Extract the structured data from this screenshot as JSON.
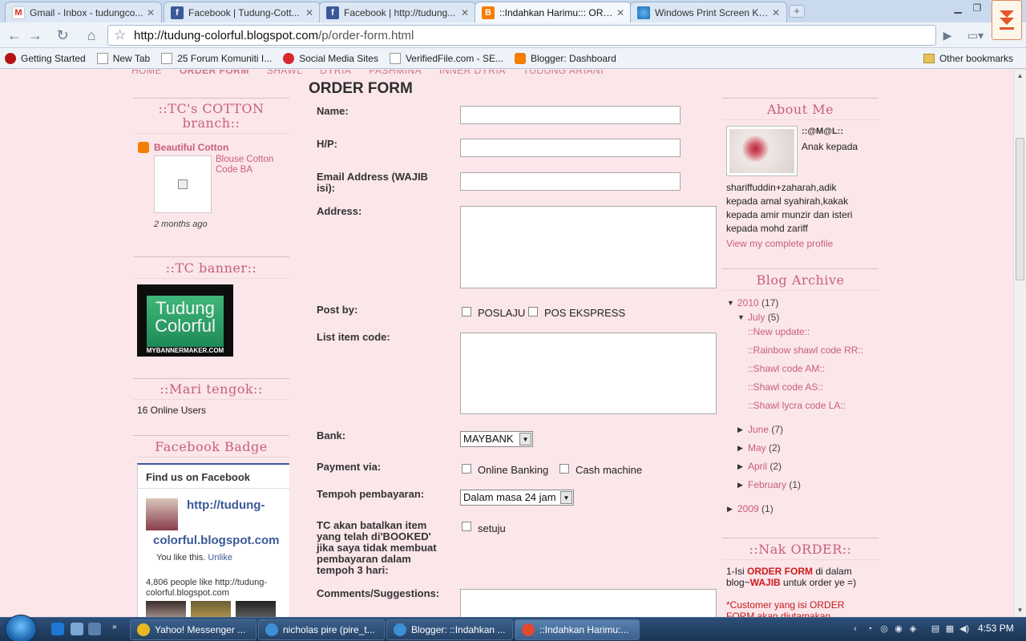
{
  "browser": {
    "tabs": [
      {
        "label": "Gmail - Inbox - tudungco...",
        "icon": "gmail-icon"
      },
      {
        "label": "Facebook | Tudung-Cott...",
        "icon": "facebook-icon"
      },
      {
        "label": "Facebook | http://tudung...",
        "icon": "facebook-icon"
      },
      {
        "label": "::Indahkan Harimu::: ORD...",
        "icon": "blogger-icon",
        "active": true
      },
      {
        "label": "Windows Print Screen Key",
        "icon": "globe-icon"
      }
    ],
    "url_host": "http://tudung-colorful.blogspot.com",
    "url_path": "/p/order-form.html",
    "bookmarks": [
      {
        "label": "Getting Started",
        "icon": "red"
      },
      {
        "label": "New Tab",
        "icon": "page"
      },
      {
        "label": "25 Forum Komuniti I...",
        "icon": "page"
      },
      {
        "label": "Social Media Sites",
        "icon": "social"
      },
      {
        "label": "VerifiedFile.com - SE...",
        "icon": "page"
      },
      {
        "label": "Blogger: Dashboard",
        "icon": "blogger"
      }
    ],
    "other_bookmarks": "Other bookmarks"
  },
  "topnav": [
    "HOME",
    "ORDER FORM",
    "SHAWL",
    "DYRIA",
    "PASHMINA",
    "INNER DYRIA",
    "TUDUNG ARIANI"
  ],
  "left": {
    "cotton_title": "::TC's COTTON branch::",
    "cotton_blog": "Beautiful Cotton",
    "cotton_post": "Blouse Cotton Code BA",
    "cotton_time": "2 months ago",
    "banner_title": "::TC banner::",
    "banner_line1": "Tudung",
    "banner_line2": "Colorful",
    "banner_footer": "MYBANNERMAKER.COM",
    "tengok_title": "::Mari tengok::",
    "online_users": "16 Online Users",
    "fb_title": "Facebook Badge",
    "fb_find": "Find us on Facebook",
    "fb_page": "http://tudung-colorful.blogspot.com",
    "fb_page_line1": "http://tudung-",
    "fb_page_line2": "colorful.blogspot.com",
    "fb_you_like": "You like this.",
    "fb_unlike": "Unlike",
    "fb_count_line1": "4,806 people like http://tudung-",
    "fb_count_line2": "colorful.blogspot.com"
  },
  "form": {
    "title": "ORDER FORM",
    "name_label": "Name:",
    "hp_label": "H/P:",
    "email_label_1": "Email Address (WAJIB",
    "email_label_2": "isi):",
    "address_label": "Address:",
    "postby_label": "Post by:",
    "post_options": [
      "POSLAJU",
      "POS EKSPRESS"
    ],
    "itemcode_label": "List item code:",
    "bank_label": "Bank:",
    "bank_value": "MAYBANK",
    "payment_label": "Payment via:",
    "payment_options": [
      "Online Banking",
      "Cash machine"
    ],
    "tempoh_label": "Tempoh pembayaran:",
    "tempoh_value": "Dalam masa 24 jam",
    "cancel_label_lines": [
      "TC akan batalkan item",
      "yang telah di'BOOKED'",
      "jika saya tidak membuat",
      "pembayaran dalam",
      "tempoh 3 hari:"
    ],
    "agree_label": "setuju",
    "comments_label": "Comments/Suggestions:"
  },
  "right": {
    "about_title": "About Me",
    "profile_name": "::@M@L::",
    "profile_intro": "Anak kepada",
    "profile_desc_lines": [
      "shariffuddin+zaharah,adik",
      "kepada amal syahirah,kakak",
      "kepada amir munzir dan isteri",
      "kepada mohd zariff"
    ],
    "view_profile": "View my complete profile",
    "archive_title": "Blog Archive",
    "year_2010": "2010",
    "year_2010_count": "(17)",
    "july": "July",
    "july_count": "(5)",
    "posts": [
      "::New update::",
      "::Rainbow shawl code RR::",
      "::Shawl code AM::",
      "::Shawl code AS::",
      "::Shawl lycra code LA::"
    ],
    "months": [
      {
        "name": "June",
        "count": "(7)"
      },
      {
        "name": "May",
        "count": "(2)"
      },
      {
        "name": "April",
        "count": "(2)"
      },
      {
        "name": "February",
        "count": "(1)"
      }
    ],
    "year_2009": "2009",
    "year_2009_count": "(1)",
    "order_title": "::Nak ORDER::",
    "order_1_prefix": "1-Isi ",
    "order_1_em": "ORDER FORM",
    "order_1_mid": " di dalam",
    "order_1_line2_a": "blog~",
    "order_1_line2_em": "WAJIB",
    "order_1_line2_b": " untuk order ye =)",
    "order_2_line1": "*Customer yang isi ORDER",
    "order_2_line2": "FORM akan diutamakan"
  },
  "taskbar": {
    "items": [
      {
        "label": "Yahoo! Messenger ...",
        "color": "#e8b923"
      },
      {
        "label": "nicholas pire (pire_t...",
        "color": "#3d8fd6"
      },
      {
        "label": "Blogger: ::Indahkan ...",
        "color": "#3d8fd6"
      },
      {
        "label": "::Indahkan Harimu:...",
        "color": "#e04a2f",
        "active": true
      }
    ],
    "clock": "4:53 PM"
  }
}
